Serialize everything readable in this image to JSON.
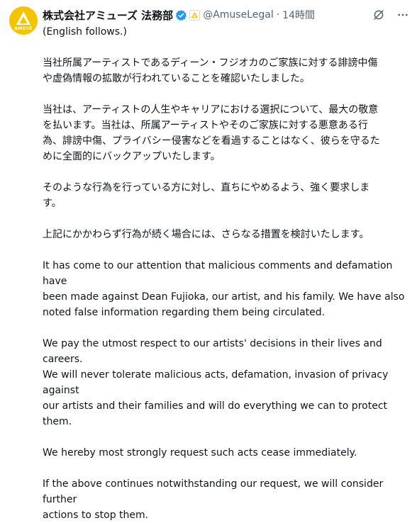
{
  "post": {
    "display_name": "株式会社アミューズ 法務部",
    "handle": "@AmuseLegal",
    "separator": "·",
    "time": "14時間",
    "avatar": {
      "text": "AMUSE",
      "color": "#f5c400"
    },
    "verified_icon": "verified-badge-icon",
    "affiliate_icon": "amuse-affiliate-badge-icon",
    "paragraphs": [
      "(English follows.)",
      "当社所属アーティストであるディーン・フジオカのご家族に対する誹謗中傷\nや虚偽情報の拡散が行われていることを確認いたしました。",
      "当社は、アーティストの人生やキャリアにおける選択について、最大の敬意\nを払います。当社は、所属アーティストやそのご家族に対する悪意ある行\n為、誹謗中傷、プライバシー侵害などを看過することはなく、彼らを守るた\nめに全面的にバックアップいたします。",
      "そのような行為を行っている方に対し、直ちにやめるよう、強く要求しま\nす。",
      "上記にかかわらず行為が続く場合には、さらなる措置を検討いたします。",
      "It has come to our attention that malicious comments and defamation have\nbeen made against Dean Fujioka, our artist, and his family. We have also\nnoted false information regarding them being circulated.",
      "We pay the utmost respect to our artists' decisions in their lives and careers.\nWe will never tolerate malicious acts, defamation, invasion of privacy against\nour artists and their families and will do everything we can to protect them.",
      "We hereby most strongly request such acts cease immediately.",
      "If the above continues notwithstanding our request, we will consider further\nactions to stop them."
    ]
  },
  "colors": {
    "text": "#0f1419",
    "muted": "#536471",
    "verified": "#1d9bf0",
    "brand": "#f5c400"
  }
}
